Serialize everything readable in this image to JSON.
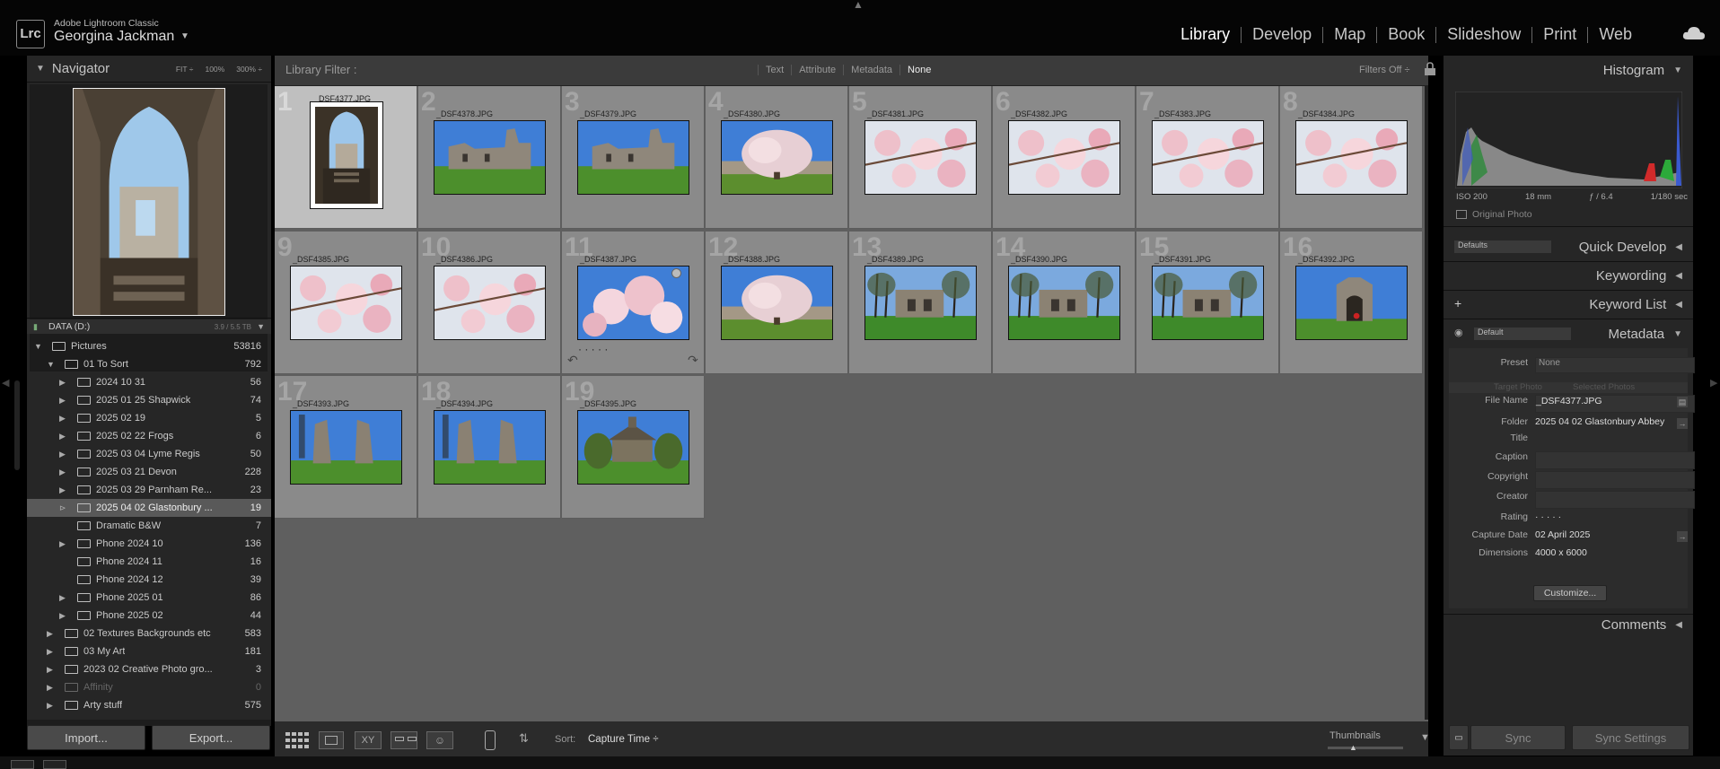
{
  "app": {
    "logo": "Lrc",
    "name": "Adobe Lightroom Classic",
    "user": "Georgina Jackman"
  },
  "modules": [
    "Library",
    "Develop",
    "Map",
    "Book",
    "Slideshow",
    "Print",
    "Web"
  ],
  "active_module": "Library",
  "navigator": {
    "title": "Navigator",
    "zooms": [
      "FIT ÷",
      "100%",
      "300% ÷"
    ]
  },
  "source": {
    "label": "DATA (D:)",
    "stats": "3.9 / 5.5 TB"
  },
  "folders": [
    {
      "label": "Pictures",
      "count": "53816",
      "level": 0,
      "expanded": true
    },
    {
      "label": "01 To Sort",
      "count": "792",
      "level": 1,
      "expanded": true
    },
    {
      "label": "2024 10 31",
      "count": "56",
      "level": 2
    },
    {
      "label": "2025 01 25 Shapwick",
      "count": "74",
      "level": 2
    },
    {
      "label": "2025 02 19",
      "count": "5",
      "level": 2
    },
    {
      "label": "2025 02 22 Frogs",
      "count": "6",
      "level": 2
    },
    {
      "label": "2025 03 04 Lyme Regis",
      "count": "50",
      "level": 2
    },
    {
      "label": "2025 03 21 Devon",
      "count": "228",
      "level": 2
    },
    {
      "label": "2025 03 29 Parnham Re...",
      "count": "23",
      "level": 2
    },
    {
      "label": "2025 04 02 Glastonbury ...",
      "count": "19",
      "level": 2,
      "selected": true
    },
    {
      "label": "Dramatic B&W",
      "count": "7",
      "level": 2,
      "noarrow": true
    },
    {
      "label": "Phone 2024 10",
      "count": "136",
      "level": 2
    },
    {
      "label": "Phone 2024 11",
      "count": "16",
      "level": 2,
      "noarrow": true
    },
    {
      "label": "Phone 2024 12",
      "count": "39",
      "level": 2,
      "noarrow": true
    },
    {
      "label": "Phone 2025 01",
      "count": "86",
      "level": 2
    },
    {
      "label": "Phone 2025 02",
      "count": "44",
      "level": 2
    },
    {
      "label": "02 Textures Backgrounds etc",
      "count": "583",
      "level": 1
    },
    {
      "label": "03 My Art",
      "count": "181",
      "level": 1
    },
    {
      "label": "2023 02 Creative Photo gro...",
      "count": "3",
      "level": 1
    },
    {
      "label": "Affinity",
      "count": "0",
      "level": 1,
      "dim": true
    },
    {
      "label": "Arty stuff",
      "count": "575",
      "level": 1
    }
  ],
  "left_buttons": {
    "import": "Import...",
    "export": "Export..."
  },
  "filter": {
    "label": "Library Filter :",
    "options": [
      "Text",
      "Attribute",
      "Metadata",
      "None"
    ],
    "active": "None",
    "status": "Filters Off ÷"
  },
  "photos": [
    {
      "num": "1",
      "name": "_DSF4377.JPG",
      "kind": "portrait",
      "scene": "ruin-arch",
      "selected": true
    },
    {
      "num": "2",
      "name": "_DSF4378.JPG",
      "kind": "land",
      "scene": "ruin"
    },
    {
      "num": "3",
      "name": "_DSF4379.JPG",
      "kind": "land",
      "scene": "ruin"
    },
    {
      "num": "4",
      "name": "_DSF4380.JPG",
      "kind": "land",
      "scene": "magtree"
    },
    {
      "num": "5",
      "name": "_DSF4381.JPG",
      "kind": "land",
      "scene": "blossom"
    },
    {
      "num": "6",
      "name": "_DSF4382.JPG",
      "kind": "land",
      "scene": "blossom"
    },
    {
      "num": "7",
      "name": "_DSF4383.JPG",
      "kind": "land",
      "scene": "blossom"
    },
    {
      "num": "8",
      "name": "_DSF4384.JPG",
      "kind": "land",
      "scene": "blossom"
    },
    {
      "num": "9",
      "name": "_DSF4385.JPG",
      "kind": "land",
      "scene": "blossom"
    },
    {
      "num": "10",
      "name": "_DSF4386.JPG",
      "kind": "land",
      "scene": "blossom"
    },
    {
      "num": "11",
      "name": "_DSF4387.JPG",
      "kind": "land",
      "scene": "blossomsky",
      "hover": true
    },
    {
      "num": "12",
      "name": "_DSF4388.JPG",
      "kind": "land",
      "scene": "magtree"
    },
    {
      "num": "13",
      "name": "_DSF4389.JPG",
      "kind": "land",
      "scene": "trees"
    },
    {
      "num": "14",
      "name": "_DSF4390.JPG",
      "kind": "land",
      "scene": "trees"
    },
    {
      "num": "15",
      "name": "_DSF4391.JPG",
      "kind": "land",
      "scene": "trees"
    },
    {
      "num": "16",
      "name": "_DSF4392.JPG",
      "kind": "land",
      "scene": "arch"
    },
    {
      "num": "17",
      "name": "_DSF4393.JPG",
      "kind": "land",
      "scene": "abbey"
    },
    {
      "num": "18",
      "name": "_DSF4394.JPG",
      "kind": "land",
      "scene": "abbey"
    },
    {
      "num": "19",
      "name": "_DSF4395.JPG",
      "kind": "land",
      "scene": "chapel"
    }
  ],
  "toolbar": {
    "sort_label": "Sort:",
    "sort_value": "Capture Time ÷",
    "thumbnails_label": "Thumbnails"
  },
  "histogram": {
    "title": "Histogram",
    "iso": "ISO 200",
    "focal": "18 mm",
    "aperture": "ƒ / 6.4",
    "shutter": "1/180 sec",
    "original": "Original Photo"
  },
  "right_panels": {
    "quick_develop": "Quick Develop",
    "keywording": "Keywording",
    "keyword_list": "Keyword List",
    "metadata": "Metadata",
    "comments": "Comments",
    "defaults": "Defaults",
    "default_preset": "Default"
  },
  "metadata": {
    "preset_label": "Preset",
    "preset_value": "None",
    "target_photo": "Target Photo",
    "selected_photos": "Selected Photos",
    "fields": [
      {
        "k": "File Name",
        "v": "_DSF4377.JPG",
        "box": true
      },
      {
        "k": "Folder",
        "v": "2025 04 02 Glastonbury Abbey",
        "box": false
      },
      {
        "k": "Title",
        "v": "",
        "box": false
      },
      {
        "k": "Caption",
        "v": "",
        "box": true
      },
      {
        "k": "Copyright",
        "v": "",
        "box": true
      },
      {
        "k": "Creator",
        "v": "",
        "box": true
      },
      {
        "k": "Rating",
        "v": "·  ·  ·  ·  ·",
        "box": false
      },
      {
        "k": "Capture Date",
        "v": "02 April 2025",
        "box": false
      },
      {
        "k": "Dimensions",
        "v": "4000 x 6000",
        "box": false
      }
    ],
    "customize": "Customize..."
  },
  "sync": {
    "sync": "Sync",
    "sync_settings": "Sync Settings"
  }
}
